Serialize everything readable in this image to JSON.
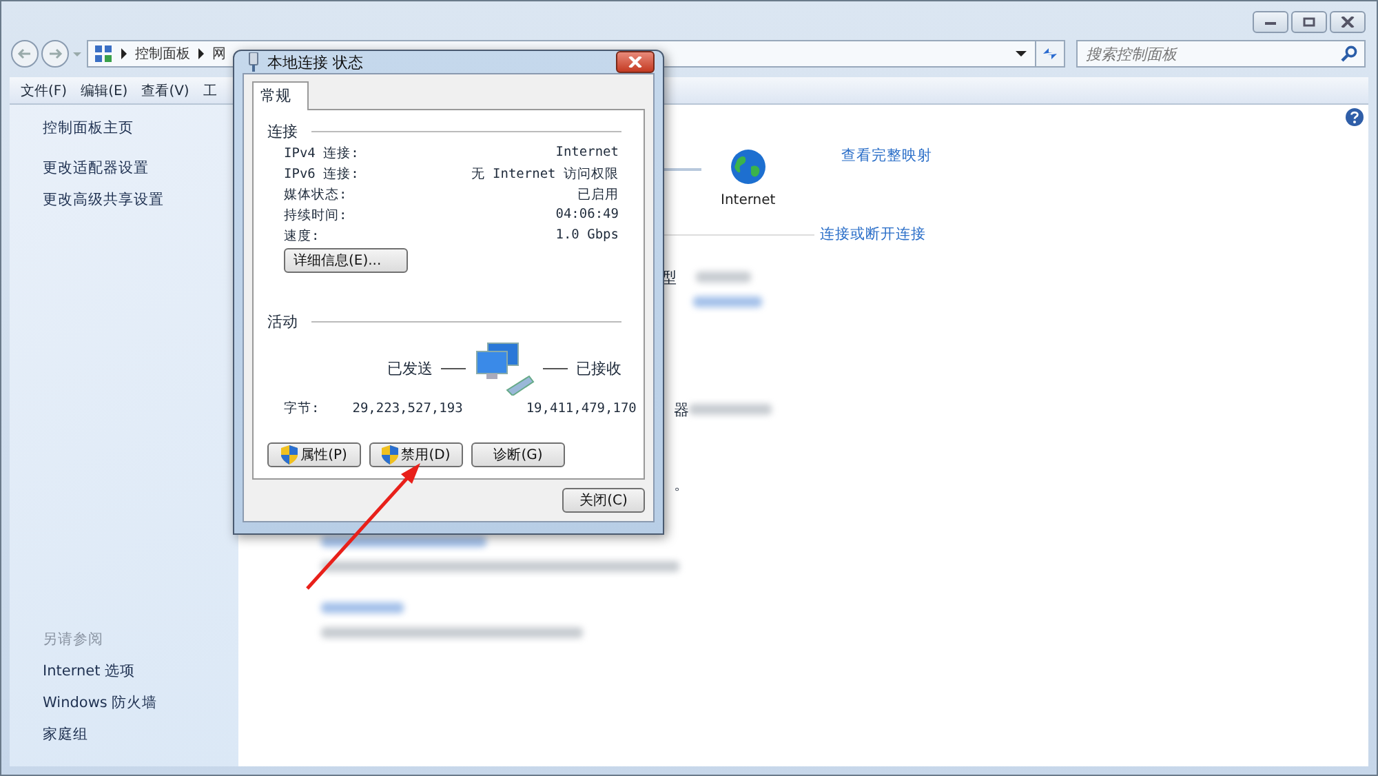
{
  "window": {
    "breadcrumb": [
      "控制面板",
      "网"
    ],
    "search": {
      "placeholder": "搜索控制面板"
    },
    "menu": [
      "文件(F)",
      "编辑(E)",
      "查看(V)",
      "工"
    ]
  },
  "sidebar": {
    "links": [
      "控制面板主页",
      "更改适配器设置",
      "更改高级共享设置"
    ],
    "see_also": {
      "heading": "另请参阅",
      "links": [
        "Internet 选项",
        "Windows 防火墙",
        "家庭组"
      ]
    }
  },
  "main": {
    "map": {
      "node_label": "Internet",
      "link": "查看完整映射"
    },
    "connect_link": "连接或断开连接",
    "fragments": [
      "型",
      "器",
      "。"
    ]
  },
  "dialog": {
    "title": "本地连接 状态",
    "tabs": [
      {
        "label": "常规",
        "selected": true
      }
    ],
    "connection": {
      "heading": "连接",
      "rows": [
        {
          "label": "IPv4 连接:",
          "value": "Internet"
        },
        {
          "label": "IPv6 连接:",
          "value": "无 Internet 访问权限"
        },
        {
          "label": "媒体状态:",
          "value": "已启用"
        },
        {
          "label": "持续时间:",
          "value": "04:06:49"
        },
        {
          "label": "速度:",
          "value": "1.0 Gbps"
        }
      ]
    },
    "details_button": "详细信息(E)...",
    "activity": {
      "heading": "活动",
      "sent_label": "已发送",
      "received_label": "已接收",
      "bytes_label": "字节:",
      "bytes_sent": "29,223,527,193",
      "bytes_received": "19,411,479,170"
    },
    "buttons": [
      {
        "label": "属性(P)",
        "shield": true
      },
      {
        "label": "禁用(D)",
        "shield": true
      },
      {
        "label": "诊断(G)",
        "shield": false
      }
    ],
    "close_button": "关闭(C)"
  }
}
